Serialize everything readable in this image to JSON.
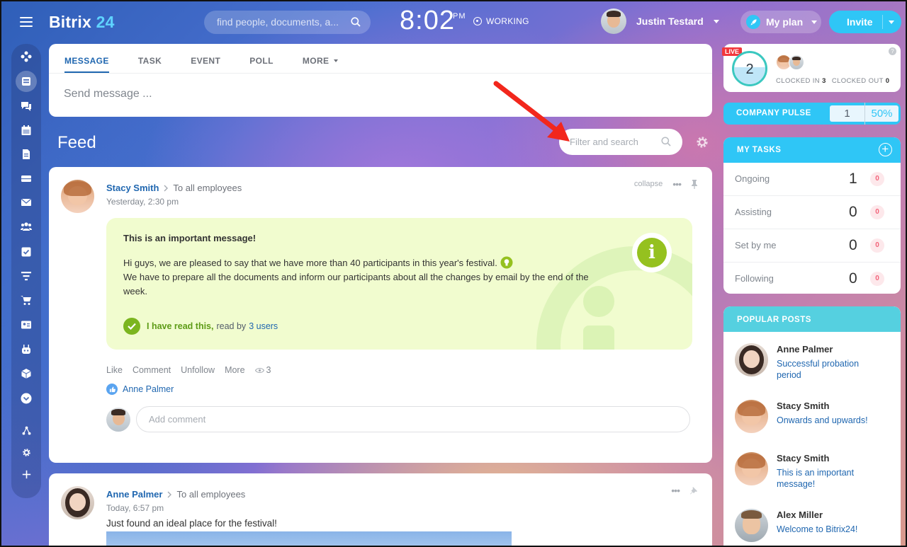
{
  "header": {
    "logo_text": "Bitrix",
    "logo_num": "24",
    "search_placeholder": "find people, documents, a...",
    "time": "8:02",
    "ampm": "PM",
    "status": "WORKING",
    "user_name": "Justin Testard",
    "plan_label": "My plan",
    "invite_label": "Invite"
  },
  "sidebar": {
    "icons": [
      "apps-icon",
      "feed-icon",
      "chat-icon",
      "calendar-icon",
      "document-icon",
      "drive-icon",
      "mail-icon",
      "groups-icon",
      "tasks-icon",
      "filter-funnel-icon",
      "cart-icon",
      "contact-card-icon",
      "robot-icon",
      "box-icon",
      "more-down-icon",
      "sitemap-icon",
      "settings-icon",
      "add-icon"
    ]
  },
  "composer": {
    "tabs": [
      "MESSAGE",
      "TASK",
      "EVENT",
      "POLL",
      "MORE"
    ],
    "placeholder": "Send message ..."
  },
  "feed": {
    "title": "Feed",
    "filter_placeholder": "Filter and search"
  },
  "post1": {
    "author": "Stacy Smith",
    "recipient": "To all employees",
    "time": "Yesterday, 2:30 pm",
    "collapse_label": "collapse",
    "title": "This is an important message!",
    "body_line1": "Hi guys, we are pleased to say that we have more than 40 participants in this year's festival.",
    "body_line2": "We have to prepare all the documents and inform our participants about all the changes by email by the end of the week.",
    "read_label": "I have read this,",
    "read_by": "read by",
    "read_users": "3 users",
    "actions": [
      "Like",
      "Comment",
      "Unfollow",
      "More"
    ],
    "views": "3",
    "liked_by": "Anne Palmer",
    "comment_placeholder": "Add comment"
  },
  "post2": {
    "author": "Anne Palmer",
    "recipient": "To all employees",
    "time": "Today, 6:57 pm",
    "text": "Just found an ideal place for the festival!"
  },
  "timeman": {
    "live": "LIVE",
    "count": "2",
    "clocked_in_label": "CLOCKED IN",
    "clocked_in": "3",
    "clocked_out_label": "CLOCKED OUT",
    "clocked_out": "0",
    "help": "?"
  },
  "pulse": {
    "label": "COMPANY PULSE",
    "value": "1",
    "percent": "50%"
  },
  "tasks": {
    "title": "MY TASKS",
    "rows": [
      {
        "label": "Ongoing",
        "count": "1",
        "badge": "0"
      },
      {
        "label": "Assisting",
        "count": "0",
        "badge": "0"
      },
      {
        "label": "Set by me",
        "count": "0",
        "badge": "0"
      },
      {
        "label": "Following",
        "count": "0",
        "badge": "0"
      }
    ]
  },
  "popular": {
    "title": "POPULAR POSTS",
    "items": [
      {
        "name": "Anne Palmer",
        "title": "Successful probation period"
      },
      {
        "name": "Stacy Smith",
        "title": "Onwards and upwards!"
      },
      {
        "name": "Stacy Smith",
        "title": "This is an important message!"
      },
      {
        "name": "Alex Miller",
        "title": "Welcome to Bitrix24!"
      }
    ]
  },
  "colors": {
    "accent": "#2fc6f6",
    "link": "#2067b0",
    "important_bg": "#f1fccf",
    "arrow": "#f2271c"
  }
}
